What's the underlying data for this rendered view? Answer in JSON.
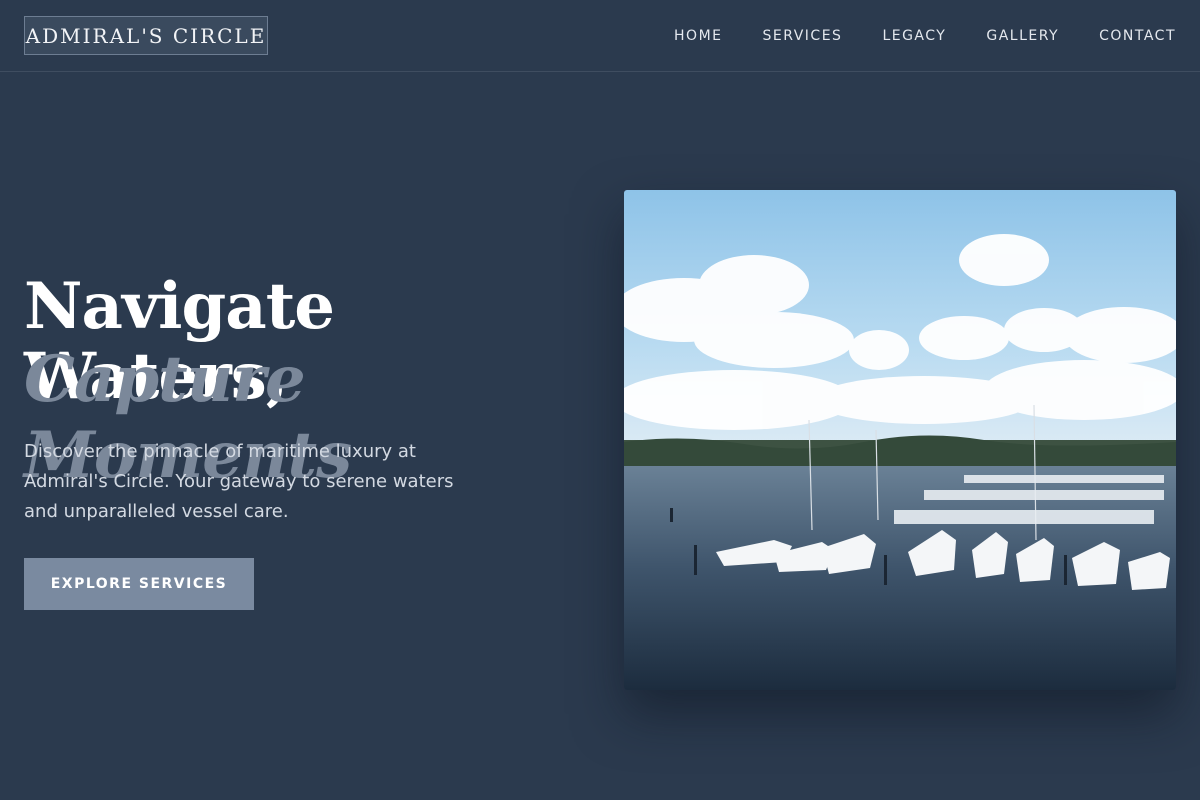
{
  "site": {
    "logo": "ADMIRAL'S CIRCLE"
  },
  "nav": {
    "items": [
      {
        "label": "HOME"
      },
      {
        "label": "SERVICES"
      },
      {
        "label": "LEGACY"
      },
      {
        "label": "GALLERY"
      },
      {
        "label": "CONTACT"
      }
    ]
  },
  "hero": {
    "title_line1": "Navigate Waters,",
    "title_line2": "Capture Moments",
    "description": "Discover the pinnacle of maritime luxury at Admiral's Circle. Your gateway to serene waters and unparalleled vessel care.",
    "cta_label": "EXPLORE SERVICES"
  },
  "colors": {
    "background": "#2b3a4e",
    "accent_button": "#7a8aa0",
    "muted_heading": "#7b889a"
  }
}
